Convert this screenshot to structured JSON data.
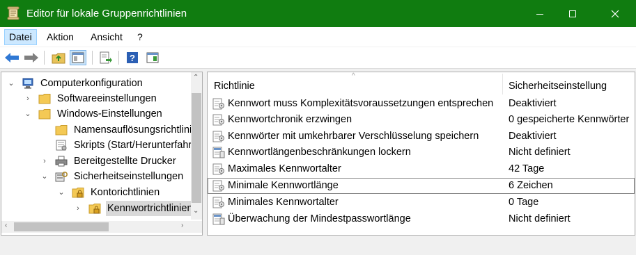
{
  "window": {
    "title": "Editor für lokale Gruppenrichtlinien",
    "accent_color": "#107c10"
  },
  "menu": {
    "items": [
      {
        "label": "Datei"
      },
      {
        "label": "Aktion"
      },
      {
        "label": "Ansicht"
      },
      {
        "label": "?"
      }
    ]
  },
  "toolbar": {
    "buttons": [
      "back-arrow-icon",
      "forward-arrow-icon",
      "folder-up-icon",
      "show-hide-tree-icon",
      "export-list-icon",
      "help-icon",
      "properties-view-icon"
    ]
  },
  "tree": {
    "items": [
      {
        "label": "Computerkonfiguration",
        "icon": "computer-icon",
        "expanded": true
      },
      {
        "label": "Softwareeinstellungen",
        "icon": "folder-icon",
        "expanded": false
      },
      {
        "label": "Windows-Einstellungen",
        "icon": "folder-icon",
        "expanded": true
      },
      {
        "label": "Namensauflösungsrichtlinie",
        "icon": "folder-icon"
      },
      {
        "label": "Skripts (Start/Herunterfahren)",
        "icon": "script-icon"
      },
      {
        "label": "Bereitgestellte Drucker",
        "icon": "printer-icon",
        "expanded": false
      },
      {
        "label": "Sicherheitseinstellungen",
        "icon": "security-icon",
        "expanded": true
      },
      {
        "label": "Kontorichtlinien",
        "icon": "folder-lock-icon",
        "expanded": true
      },
      {
        "label": "Kennwortrichtlinien",
        "icon": "folder-lock-icon",
        "selected": true
      }
    ]
  },
  "list": {
    "columns": [
      "Richtlinie",
      "Sicherheitseinstellung"
    ],
    "rows": [
      {
        "name": "Kennwort muss Komplexitätsvoraussetzungen entsprechen",
        "value": "Deaktiviert",
        "icon": "policy-icon"
      },
      {
        "name": "Kennwortchronik erzwingen",
        "value": "0 gespeicherte Kennwörter",
        "icon": "policy-icon"
      },
      {
        "name": "Kennwörter mit umkehrbarer Verschlüsselung speichern",
        "value": "Deaktiviert",
        "icon": "policy-icon"
      },
      {
        "name": "Kennwortlängenbeschränkungen lockern",
        "value": "Nicht definiert",
        "icon": "policy-doc-icon"
      },
      {
        "name": "Maximales Kennwortalter",
        "value": "42 Tage",
        "icon": "policy-icon"
      },
      {
        "name": "Minimale Kennwortlänge",
        "value": "6 Zeichen",
        "icon": "policy-icon",
        "focused": true
      },
      {
        "name": "Minimales Kennwortalter",
        "value": "0 Tage",
        "icon": "policy-icon"
      },
      {
        "name": "Überwachung der Mindestpasswortlänge",
        "value": "Nicht definiert",
        "icon": "policy-doc-icon"
      }
    ]
  }
}
